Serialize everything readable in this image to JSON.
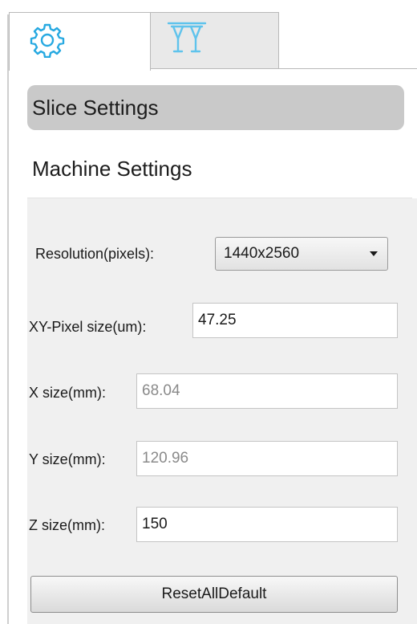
{
  "tabs": [
    {
      "icon": "gear-icon",
      "selected": true
    },
    {
      "icon": "printer-support-icon",
      "selected": false
    }
  ],
  "sections": {
    "slice_settings": "Slice Settings",
    "machine_settings": "Machine Settings"
  },
  "form": {
    "resolution_label": "Resolution(pixels):",
    "resolution_value": "1440x2560",
    "xy_pixel_label": "XY-Pixel size(um):",
    "xy_pixel_value": "47.25",
    "x_size_label": "X size(mm):",
    "x_size_value": "68.04",
    "y_size_label": "Y size(mm):",
    "y_size_value": "120.96",
    "z_size_label": "Z size(mm):",
    "z_size_value": "150"
  },
  "buttons": {
    "reset_label": "ResetAllDefault"
  },
  "colors": {
    "accent_icon": "#27a9e1",
    "selected_section_bg": "#c9c9c9"
  }
}
